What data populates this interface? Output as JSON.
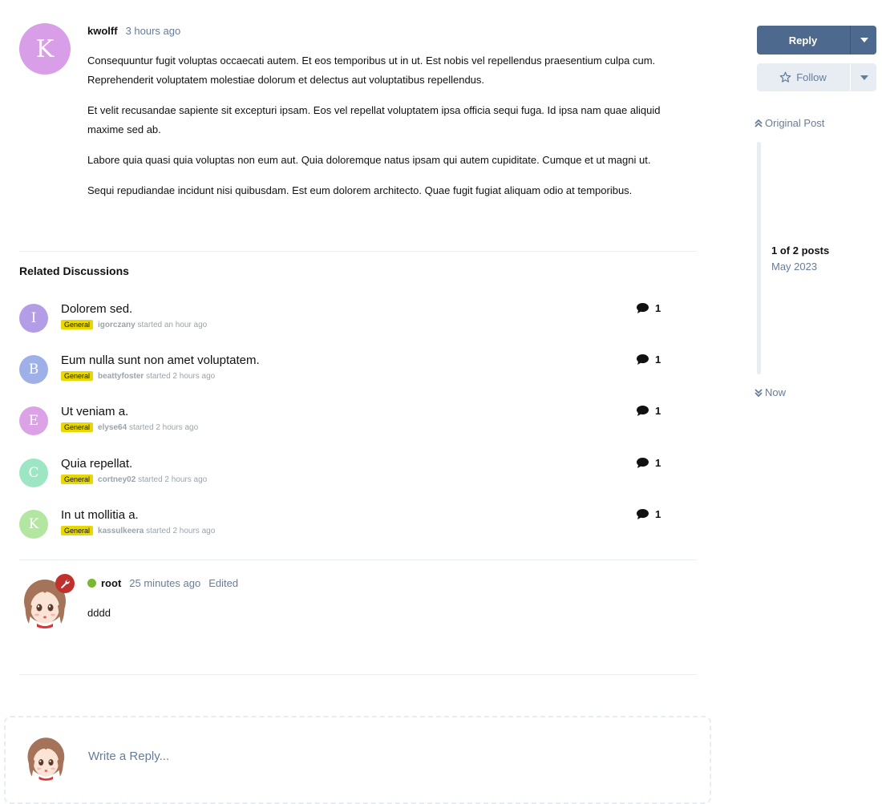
{
  "first_post": {
    "avatar_letter": "K",
    "avatar_color": "#d99ee8",
    "username": "kwolff",
    "time": "3 hours ago",
    "paragraphs": [
      "Consequuntur fugit voluptas occaecati autem. Et eos temporibus ut in ut. Est nobis vel repellendus praesentium culpa cum. Reprehenderit voluptatem molestiae dolorum et delectus aut voluptatibus repellendus.",
      "Et velit recusandae sapiente sit excepturi ipsam. Eos vel repellat voluptatem ipsa officia sequi fuga. Id ipsa nam quae aliquid maxime sed ab.",
      "Labore quia quasi quia voluptas non eum aut. Quia doloremque natus ipsam qui autem cupiditate. Cumque et ut magni ut.",
      "Sequi repudiandae incidunt nisi quibusdam. Est eum dolorem architecto. Quae fugit fugiat aliquam odio at temporibus."
    ]
  },
  "related": {
    "title": "Related Discussions",
    "items": [
      {
        "letter": "I",
        "color": "#b39de6",
        "title": "Dolorem sed.",
        "tag": "General",
        "user": "igorczany",
        "started": "started an hour ago",
        "count": "1"
      },
      {
        "letter": "B",
        "color": "#9fb0e8",
        "title": "Eum nulla sunt non amet voluptatem.",
        "tag": "General",
        "user": "beattyfoster",
        "started": "started 2 hours ago",
        "count": "1"
      },
      {
        "letter": "E",
        "color": "#dba3e6",
        "title": "Ut veniam a.",
        "tag": "General",
        "user": "elyse64",
        "started": "started 2 hours ago",
        "count": "1"
      },
      {
        "letter": "C",
        "color": "#9de6c4",
        "title": "Quia repellat.",
        "tag": "General",
        "user": "cortney02",
        "started": "started 2 hours ago",
        "count": "1"
      },
      {
        "letter": "K",
        "color": "#b3e6a1",
        "title": "In ut mollitia a.",
        "tag": "General",
        "user": "kassulkeera",
        "started": "started 2 hours ago",
        "count": "1"
      }
    ]
  },
  "second_post": {
    "username": "root",
    "time": "25 minutes ago",
    "edited": "Edited",
    "body": "dddd"
  },
  "sidebar": {
    "reply": "Reply",
    "follow": "Follow",
    "original_post": "Original Post",
    "count": "1 of 2 posts",
    "date": "May 2023",
    "now": "Now"
  },
  "composer": {
    "placeholder": "Write a Reply..."
  },
  "colors": {
    "primary": "#4d698e",
    "muted": "#667d99",
    "tag": "#e6d800",
    "online": "#7ab82e",
    "badge": "#c0302d"
  }
}
